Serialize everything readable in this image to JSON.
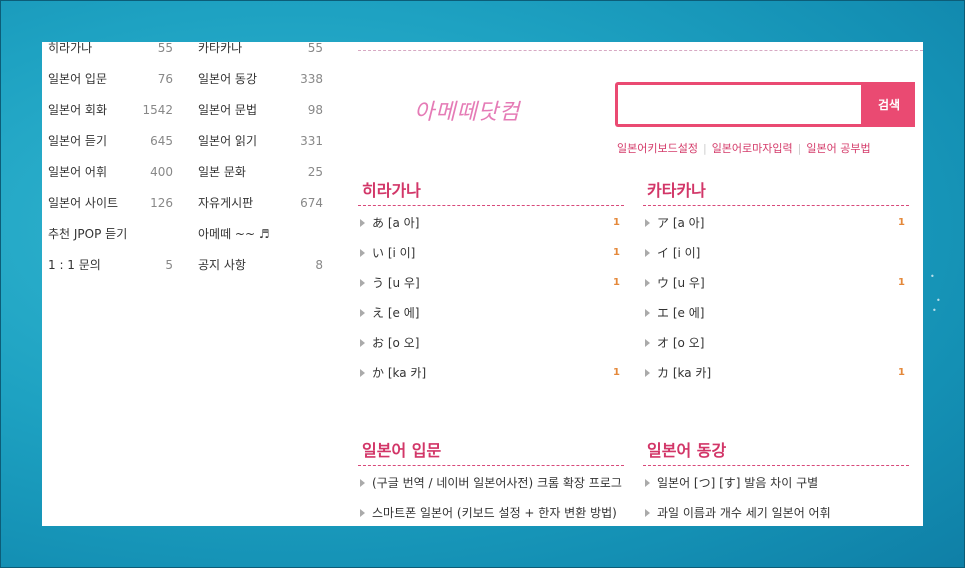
{
  "categories": [
    {
      "left": {
        "label": "히라가나",
        "count": "55"
      },
      "right": {
        "label": "카타카나",
        "count": "55"
      }
    },
    {
      "left": {
        "label": "일본어 입문",
        "count": "76"
      },
      "right": {
        "label": "일본어 동강",
        "count": "338"
      }
    },
    {
      "left": {
        "label": "일본어 회화",
        "count": "1542"
      },
      "right": {
        "label": "일본어 문법",
        "count": "98"
      }
    },
    {
      "left": {
        "label": "일본어 듣기",
        "count": "645"
      },
      "right": {
        "label": "일본어 읽기",
        "count": "331"
      }
    },
    {
      "left": {
        "label": "일본어 어휘",
        "count": "400"
      },
      "right": {
        "label": "일본 문화",
        "count": "25"
      }
    },
    {
      "left": {
        "label": "일본어 사이트",
        "count": "126"
      },
      "right": {
        "label": "자유게시판",
        "count": "674"
      }
    },
    {
      "left": {
        "label": "추천 JPOP 듣기",
        "count": ""
      },
      "right": {
        "label": "아메떼 ~~ ♬",
        "count": ""
      }
    },
    {
      "left": {
        "label": "1 : 1 문의",
        "count": "5"
      },
      "right": {
        "label": "공지 사항",
        "count": "8"
      }
    }
  ],
  "logo_text": "아메떼닷컴",
  "search": {
    "placeholder": "",
    "button_label": "검색"
  },
  "quick_links": [
    "일본어키보드설정",
    "일본어로마자입력",
    "일본어 공부법"
  ],
  "boards": [
    {
      "title": "히라가나",
      "items": [
        {
          "text": "あ [a 아]",
          "count": "1"
        },
        {
          "text": "い [i 이]",
          "count": "1"
        },
        {
          "text": "う [u 우]",
          "count": "1"
        },
        {
          "text": "え [e 에]",
          "count": ""
        },
        {
          "text": "お [o 오]",
          "count": ""
        },
        {
          "text": "か [ka 카]",
          "count": "1"
        }
      ]
    },
    {
      "title": "카타카나",
      "items": [
        {
          "text": "ア [a 아]",
          "count": "1"
        },
        {
          "text": "イ [i 이]",
          "count": ""
        },
        {
          "text": "ウ [u 우]",
          "count": "1"
        },
        {
          "text": "エ [e 에]",
          "count": ""
        },
        {
          "text": "オ [o 오]",
          "count": ""
        },
        {
          "text": "カ [ka 카]",
          "count": "1"
        }
      ]
    },
    {
      "title": "일본어 입문",
      "items": [
        {
          "text": "(구글 번역 / 네이버 일본어사전) 크롬 확장 프로그램",
          "count": ""
        },
        {
          "text": "스마트폰 일본어 (키보드 설정 + 한자 변환 방법)",
          "count": ""
        }
      ]
    },
    {
      "title": "일본어 동강",
      "items": [
        {
          "text": "일본어 [つ] [す] 발음 차이 구별",
          "count": ""
        },
        {
          "text": "과일 이름과 개수 세기 일본어 어휘",
          "count": ""
        }
      ]
    }
  ],
  "colors": {
    "accent": "#ea4a72",
    "title": "#d23668",
    "count": "#e4883a",
    "background": "#1ea2c2"
  }
}
